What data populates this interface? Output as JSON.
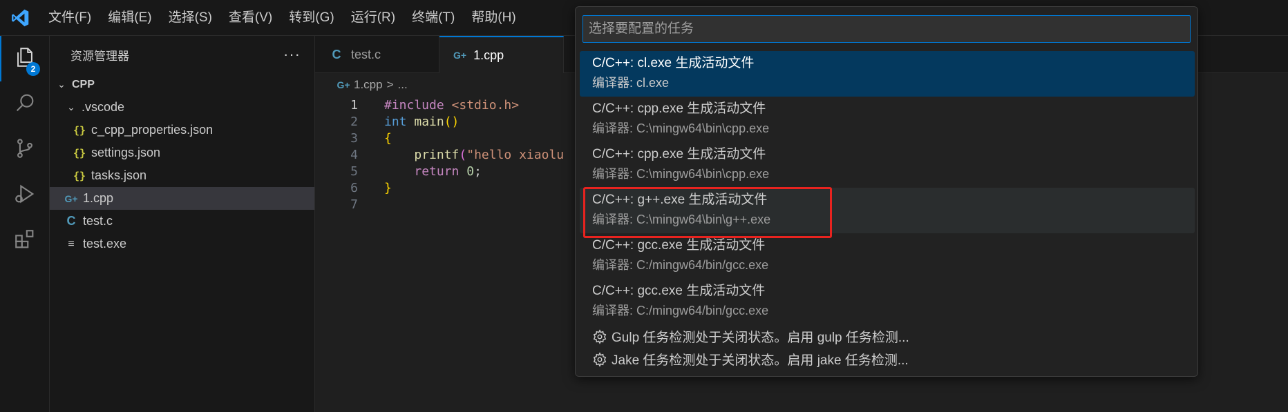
{
  "menu": [
    "文件(F)",
    "编辑(E)",
    "选择(S)",
    "查看(V)",
    "转到(G)",
    "运行(R)",
    "终端(T)",
    "帮助(H)"
  ],
  "activity": {
    "explorer_badge": "2"
  },
  "sidebar": {
    "title": "资源管理器",
    "more": "···",
    "tree": {
      "root": "CPP",
      "vscode_folder": ".vscode",
      "files_vscode": [
        "c_cpp_properties.json",
        "settings.json",
        "tasks.json"
      ],
      "file_cpp": "1.cpp",
      "file_c": "test.c",
      "file_exe": "test.exe"
    },
    "icons": {
      "json": "{}",
      "cpp": "G+",
      "c": "C",
      "exe": "≡"
    }
  },
  "tabs": [
    {
      "label": "test.c",
      "icon": "C"
    },
    {
      "label": "1.cpp",
      "icon": "G+"
    }
  ],
  "breadcrumb": {
    "file": "1.cpp",
    "sep": ">",
    "rest": "..."
  },
  "editor": {
    "line_numbers": [
      "1",
      "2",
      "3",
      "4",
      "5",
      "6",
      "7"
    ],
    "code": {
      "l1_pp": "#include",
      "l1_inc": "<stdio.h>",
      "l2_type": "int",
      "l2_fn": "main",
      "l2_paren": "()",
      "l3_brace": "{",
      "l4_fn": "printf",
      "l4_paren": "(",
      "l4_str": "\"hello xiaolu",
      "l5_ret": "return",
      "l5_num": "0",
      "l5_semi": ";",
      "l6_brace": "}"
    }
  },
  "quickpick": {
    "placeholder": "选择要配置的任务",
    "items": [
      {
        "label": "C/C++: cl.exe 生成活动文件",
        "desc": "编译器: cl.exe"
      },
      {
        "label": "C/C++: cpp.exe 生成活动文件",
        "desc": "编译器: C:\\mingw64\\bin\\cpp.exe"
      },
      {
        "label": "C/C++: cpp.exe 生成活动文件",
        "desc": "编译器: C:\\mingw64\\bin\\cpp.exe"
      },
      {
        "label": "C/C++: g++.exe 生成活动文件",
        "desc": "编译器: C:\\mingw64\\bin\\g++.exe"
      },
      {
        "label": "C/C++: gcc.exe 生成活动文件",
        "desc": "编译器: C:/mingw64/bin/gcc.exe"
      },
      {
        "label": "C/C++: gcc.exe 生成活动文件",
        "desc": "编译器: C:/mingw64/bin/gcc.exe"
      }
    ],
    "actions": [
      "Gulp 任务检测处于关闭状态。启用 gulp 任务检测...",
      "Jake 任务检测处于关闭状态。启用 jake 任务检测..."
    ]
  },
  "colors": {
    "accent": "#0078d4",
    "selection": "#04395e",
    "highlight_border": "#e8231f"
  }
}
